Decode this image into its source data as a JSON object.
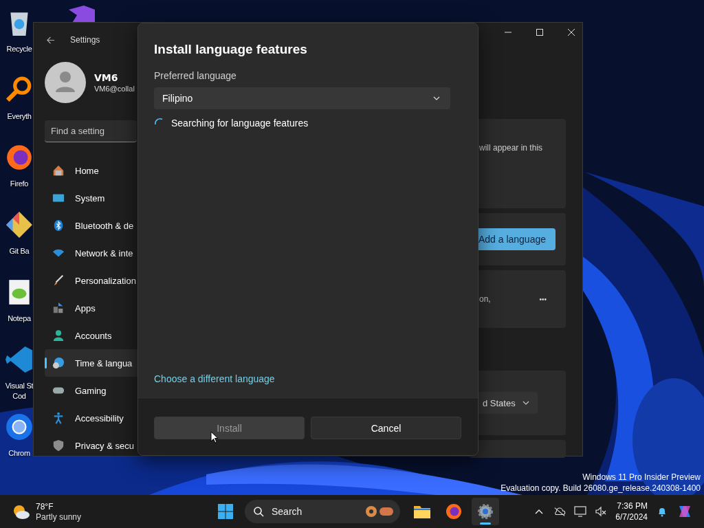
{
  "desktop_icons": [
    {
      "kind": "recycle",
      "lines": [
        "Recycle"
      ]
    },
    {
      "kind": "magnifier",
      "lines": [
        "Everyth"
      ]
    },
    {
      "kind": "firefox",
      "lines": [
        "Firefo"
      ]
    },
    {
      "kind": "git",
      "lines": [
        "Git Ba"
      ]
    },
    {
      "kind": "notepad",
      "lines": [
        "Notepa"
      ]
    },
    {
      "kind": "vscode",
      "lines": [
        "Visual St",
        "Cod"
      ]
    },
    {
      "kind": "chrome",
      "lines": [
        "Chrom"
      ]
    },
    {
      "kind": "studio"
    }
  ],
  "settings": {
    "title": "Settings",
    "user_name": "VM6",
    "user_email": "VM6@collal",
    "search": {
      "placeholder": "Find a setting"
    },
    "nav_items": [
      {
        "kind": "home",
        "label": "Home",
        "selected": false
      },
      {
        "kind": "system",
        "label": "System",
        "selected": false
      },
      {
        "kind": "bluetooth",
        "label": "Bluetooth & de",
        "selected": false
      },
      {
        "kind": "network",
        "label": "Network & inte",
        "selected": false
      },
      {
        "kind": "brush",
        "label": "Personalization",
        "selected": false
      },
      {
        "kind": "apps",
        "label": "Apps",
        "selected": false
      },
      {
        "kind": "accounts",
        "label": "Accounts",
        "selected": false
      },
      {
        "kind": "time",
        "label": "Time & langua",
        "selected": true
      },
      {
        "kind": "gaming",
        "label": "Gaming",
        "selected": false
      },
      {
        "kind": "accessibility",
        "label": "Accessibility",
        "selected": false
      },
      {
        "kind": "privacy",
        "label": "Privacy & secu",
        "selected": false
      }
    ],
    "background_content": {
      "card_text": "will appear in this",
      "add_button": "Add a language",
      "language_card_text": "on,",
      "more_button": "•••",
      "region_dropdown": "d States"
    }
  },
  "dialog": {
    "title": "Install language features",
    "field_label": "Preferred language",
    "dropdown_value": "Filipino",
    "status": "Searching for language features",
    "link": "Choose a different language",
    "buttons": [
      {
        "kind": "primary",
        "label": "Install",
        "disabled": true
      },
      {
        "kind": "secondary",
        "label": "Cancel",
        "disabled": false
      }
    ]
  },
  "watermark": [
    "Windows 11 Pro Insider Preview",
    "Evaluation copy. Build 26080.ge_release.240308-1400"
  ],
  "taskbar": {
    "weather": {
      "temperature": "78°F",
      "condition": "Partly sunny"
    },
    "search": {
      "placeholder": "Search"
    },
    "apps": [
      {
        "kind": "explorer",
        "selected": false
      },
      {
        "kind": "firefox",
        "selected": false
      },
      {
        "kind": "settings",
        "selected": true
      }
    ],
    "time": "7:36 PM",
    "date": "6/7/2024"
  }
}
